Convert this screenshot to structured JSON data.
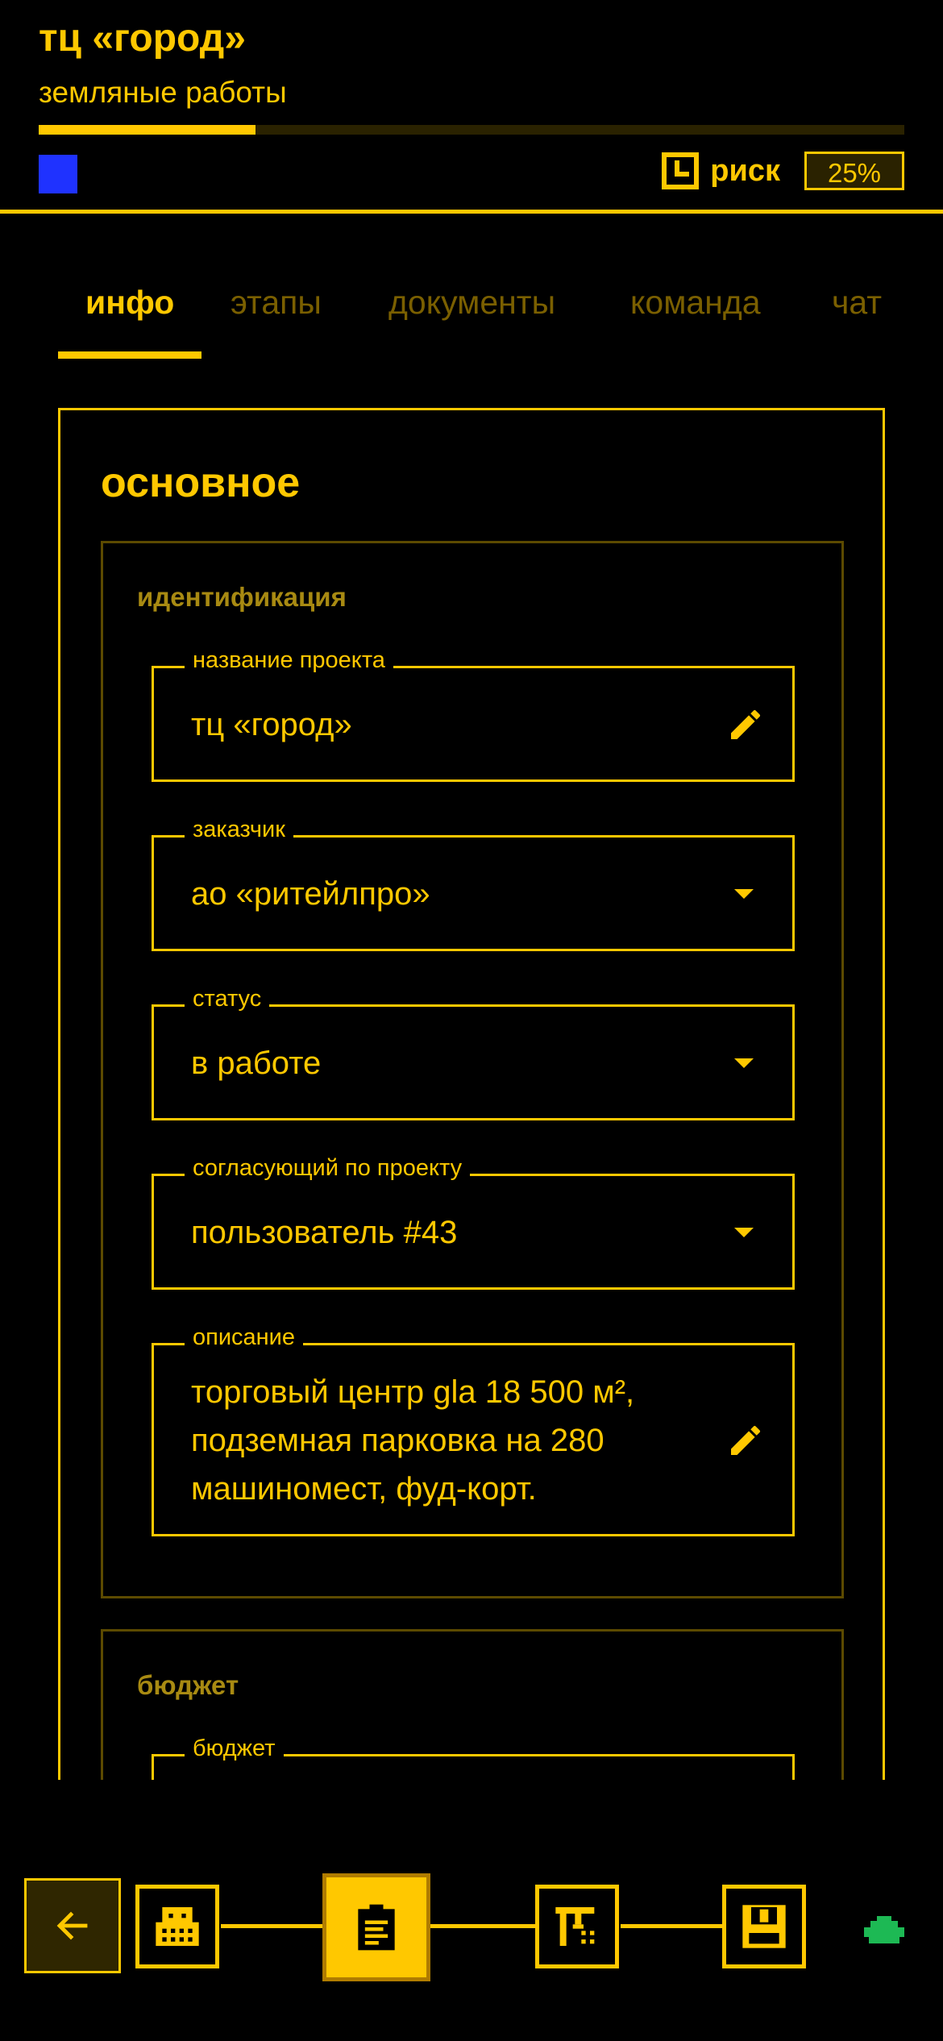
{
  "header": {
    "title": "тц «город»",
    "subtitle": "земляные работы",
    "progress": 0.25,
    "risk_label": "риск",
    "risk_value": "25%",
    "status_color": "#1F32FF",
    "accent_color": "#FFC800"
  },
  "tabs": [
    {
      "label": "инфо",
      "active": true
    },
    {
      "label": "этапы",
      "active": false
    },
    {
      "label": "документы",
      "active": false
    },
    {
      "label": "команда",
      "active": false
    },
    {
      "label": "чат",
      "active": false
    }
  ],
  "card": {
    "title": "основное",
    "sections": {
      "identification": {
        "title": "идентификация",
        "fields": [
          {
            "label": "название проекта",
            "value": "тц «город»",
            "control": "edit-icon"
          },
          {
            "label": "заказчик",
            "value": "ао «ритейлпро»",
            "control": "dropdown"
          },
          {
            "label": "статус",
            "value": "в работе",
            "control": "dropdown"
          },
          {
            "label": "согласующий по проекту",
            "value": "пользователь #43",
            "control": "dropdown"
          },
          {
            "label": "описание",
            "value": "торговый центр gla 18 500 м², подземная парковка на 280 машиномест, фуд-корт.",
            "control": "edit-icon"
          }
        ]
      },
      "budget": {
        "title": "бюджет",
        "field_label": "бюджет"
      }
    }
  },
  "bottom_nav": {
    "back_icon": "arrow-left-icon",
    "steps": [
      "building-icon",
      "document-icon",
      "crane-icon",
      "save-icon"
    ],
    "active_step": 1,
    "status_icon": "green-cloud-icon",
    "status_color": "#1DB954"
  }
}
